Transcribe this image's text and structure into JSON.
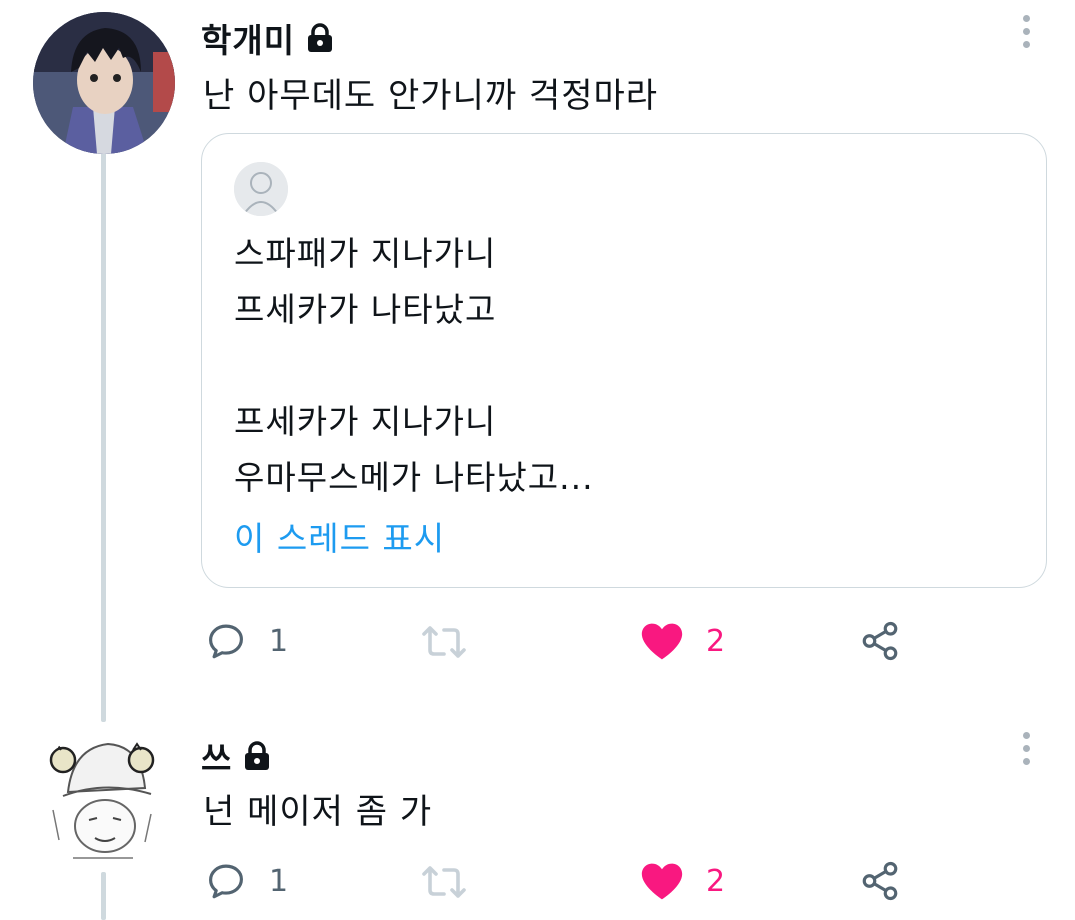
{
  "tweets": [
    {
      "author": "학개미",
      "text": "난 아무데도 안가니까 걱정마라",
      "quote": {
        "lines": [
          "스파패가 지나가니",
          "프세카가 나타났고",
          "",
          "프세카가 지나가니",
          "우마무스메가 나타났고..."
        ],
        "show_thread": "이 스레드 표시"
      },
      "actions": {
        "reply_count": "1",
        "like_count": "2"
      }
    },
    {
      "author": "쓰",
      "text": "넌 메이저 좀 가",
      "actions": {
        "reply_count": "1",
        "like_count": "2"
      }
    }
  ],
  "icons": {
    "lock": "lock-icon",
    "more": "more-vertical-icon",
    "reply": "reply-icon",
    "retweet": "retweet-icon",
    "like": "heart-icon",
    "share": "share-icon"
  },
  "colors": {
    "accent": "#1d9bf0",
    "like": "#f91880",
    "muted": "#536471",
    "line": "#cfd9de"
  }
}
